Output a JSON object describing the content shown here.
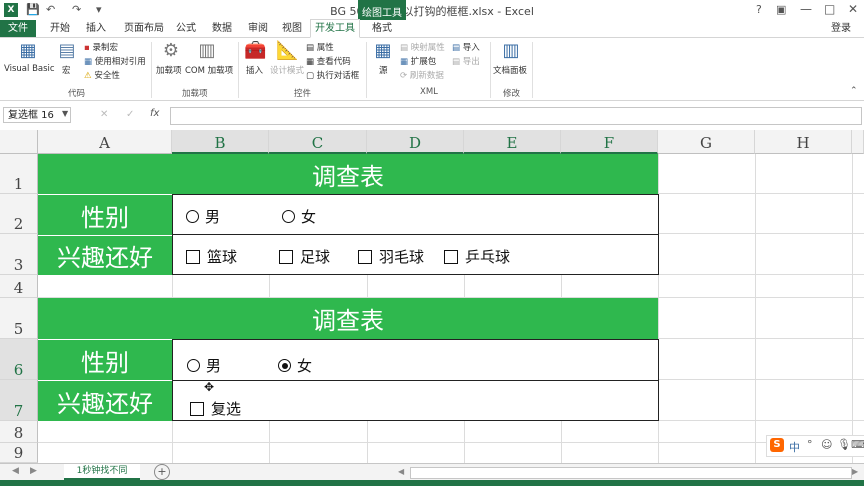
{
  "window": {
    "title": "BG 505 13 可以打钩的框框.xlsx - Excel",
    "context_group": "绘图工具",
    "login": "登录"
  },
  "tabs": [
    "文件",
    "开始",
    "插入",
    "页面布局",
    "公式",
    "数据",
    "审阅",
    "视图",
    "开发工具",
    "格式"
  ],
  "active_tab": "开发工具",
  "ribbon": {
    "code": {
      "name": "代码",
      "visual_basic": "Visual Basic",
      "macro": "宏",
      "record": "录制宏",
      "relative": "使用相对引用",
      "security": "安全性"
    },
    "addins": {
      "name": "加载项",
      "addins": "加载项",
      "com": "COM 加载项"
    },
    "controls": {
      "name": "控件",
      "insert": "插入",
      "design": "设计模式",
      "properties": "属性",
      "view_code": "查看代码",
      "run_dialog": "执行对话框"
    },
    "xml": {
      "name": "XML",
      "source": "源",
      "map_props": "映射属性",
      "expansion": "扩展包",
      "refresh": "刷新数据",
      "import": "导入",
      "export": "导出"
    },
    "modify": {
      "name": "修改",
      "doc_panel": "文档面板"
    }
  },
  "formula_bar": {
    "name_box": "复选框 16",
    "fx": "fx",
    "cancel": "✕",
    "enter": "✓",
    "content": ""
  },
  "columns": [
    "A",
    "B",
    "C",
    "D",
    "E",
    "F",
    "G",
    "H"
  ],
  "rows": [
    "1",
    "2",
    "3",
    "4",
    "5",
    "6",
    "7",
    "8",
    "9"
  ],
  "table1": {
    "title": "调查表",
    "gender_label": "性别",
    "interest_label": "兴趣还好",
    "gender_options": [
      "男",
      "女"
    ],
    "interest_options": [
      "篮球",
      "足球",
      "羽毛球",
      "乒乓球"
    ]
  },
  "table2": {
    "title": "调查表",
    "gender_label": "性别",
    "interest_label": "兴趣还好",
    "gender_options": [
      "男",
      "女"
    ],
    "selected_gender": "女",
    "checkbox_label": "复选"
  },
  "sheet_tabs": [
    "1秒钟找不同"
  ],
  "add_sheet": "+",
  "ime": {
    "logo": "S",
    "lang": "中"
  },
  "colors": {
    "excel_green": "#217346",
    "band_green": "#2fb84e"
  }
}
